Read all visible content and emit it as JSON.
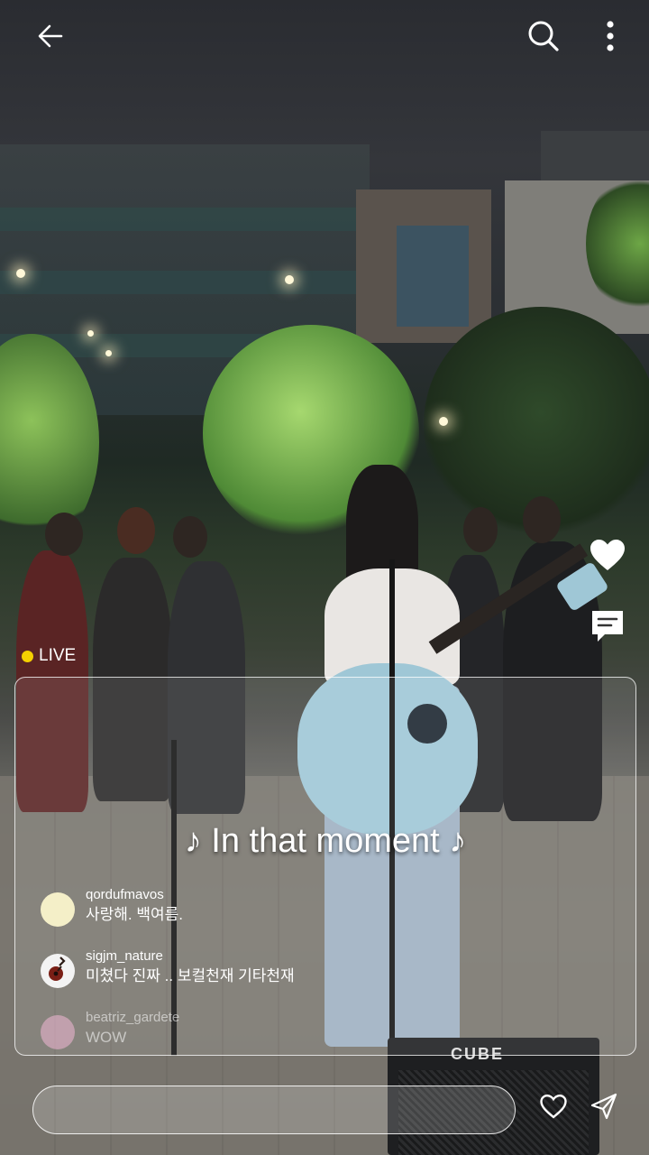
{
  "header": {
    "back_icon": "arrow-left-icon",
    "search_icon": "search-icon",
    "more_icon": "more-vertical-icon"
  },
  "side_actions": {
    "like_icon": "heart-icon",
    "chat_icon": "chat-bubble-icon"
  },
  "live_badge": {
    "label": "LIVE",
    "dot_color": "#f5d000"
  },
  "caption": "♪ In that moment ♪",
  "comments": [
    {
      "username": "qordufmavos",
      "text": "사랑해. 백여름.",
      "avatar_color": "#f4efc8"
    },
    {
      "username": "sigjm_nature",
      "text": "미쳤다 진짜 .. 보컬천재 기타천재",
      "avatar_icon": "guitar-icon"
    },
    {
      "username": "beatriz_gardete",
      "text": "WOW",
      "avatar_color": "#f2b9d6"
    }
  ],
  "comment_input": {
    "placeholder": "",
    "like_icon": "heart-outline-icon",
    "send_icon": "send-icon"
  },
  "amp_brand": "CUBE"
}
